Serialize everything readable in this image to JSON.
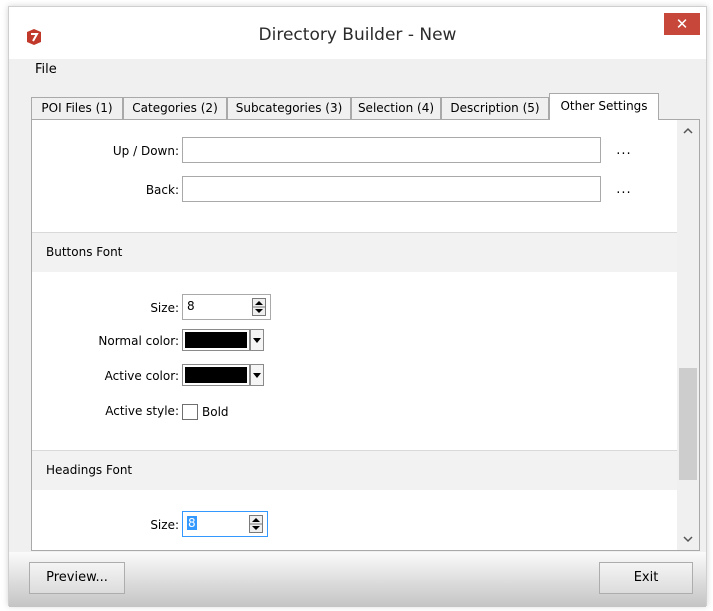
{
  "window": {
    "title": "Directory Builder - New",
    "close_glyph": "✕"
  },
  "menu": {
    "file": "File"
  },
  "tabs": [
    {
      "label": "POI Files (1)"
    },
    {
      "label": "Categories (2)"
    },
    {
      "label": "Subcategories (3)"
    },
    {
      "label": "Selection (4)"
    },
    {
      "label": "Description (5)"
    },
    {
      "label": "Other Settings",
      "active": true
    }
  ],
  "fields": {
    "up_down": {
      "label": "Up / Down:",
      "value": "",
      "browse": "..."
    },
    "back": {
      "label": "Back:",
      "value": "",
      "browse": "..."
    }
  },
  "buttons_font": {
    "header": "Buttons Font",
    "size_label": "Size:",
    "size_value": "8",
    "normal_color_label": "Normal color:",
    "normal_color": "#000000",
    "active_color_label": "Active color:",
    "active_color": "#000000",
    "active_style_label": "Active style:",
    "bold_label": "Bold",
    "bold_checked": false
  },
  "headings_font": {
    "header": "Headings Font",
    "size_label": "Size:",
    "size_value": "8"
  },
  "footer": {
    "preview": "Preview...",
    "exit": "Exit"
  },
  "colors": {
    "close_button": "#c7483b",
    "app_icon": "#c0392b",
    "selection": "#3399ff"
  }
}
